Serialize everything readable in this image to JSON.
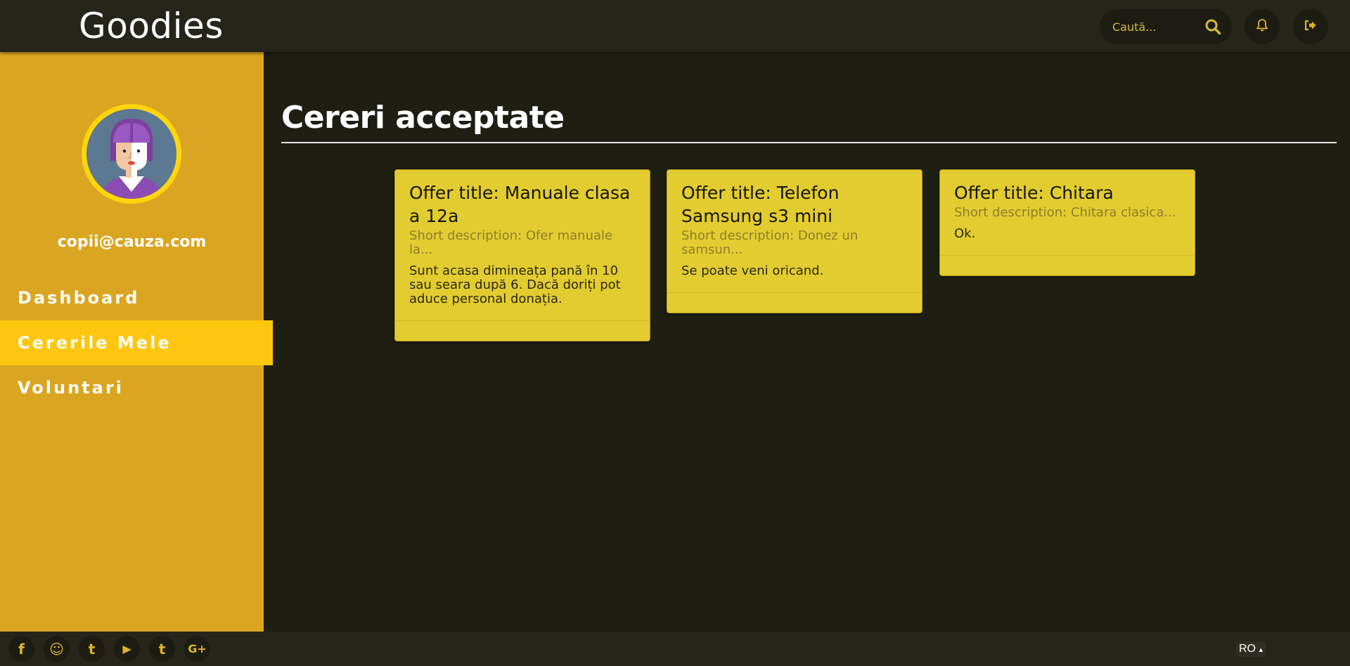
{
  "header": {
    "brand": "Goodies",
    "search_placeholder": "Caută...",
    "icons": [
      "search-icon",
      "bell-icon",
      "sign-out-icon"
    ]
  },
  "sidebar": {
    "user_email": "copii@cauza.com",
    "nav": [
      {
        "label": "Dashboard",
        "active": false
      },
      {
        "label": "Cererile Mele",
        "active": true
      },
      {
        "label": "Voluntari",
        "active": false
      }
    ]
  },
  "main": {
    "title": "Cereri acceptate",
    "cards": [
      {
        "title": "Offer title: Manuale clasa a 12a",
        "short_description": "Short description: Ofer manuale la...",
        "text": "Sunt acasa dimineața pană în 10 sau seara după 6. Dacă doriți pot aduce personal donația."
      },
      {
        "title": "Offer title: Telefon Samsung s3 mini",
        "short_description": "Short description: Donez un samsun...",
        "text": "Se poate veni oricand."
      },
      {
        "title": "Offer title: Chitara",
        "short_description": "Short description: Chitara clasica...",
        "text": "Ok."
      }
    ]
  },
  "footer": {
    "social": [
      {
        "name": "facebook-icon",
        "glyph": "f"
      },
      {
        "name": "github-icon",
        "glyph": "☺"
      },
      {
        "name": "twitter-icon",
        "glyph": "t"
      },
      {
        "name": "youtube-icon",
        "glyph": "▶"
      },
      {
        "name": "tumblr-icon",
        "glyph": "t"
      },
      {
        "name": "google-plus-icon",
        "glyph": "G+"
      }
    ],
    "language": "RO",
    "language_caret": "▴"
  },
  "colors": {
    "accent": "#ffc60f",
    "sidebar": "#daa520",
    "card": "#e3cc2f",
    "background": "#1e1e13"
  }
}
